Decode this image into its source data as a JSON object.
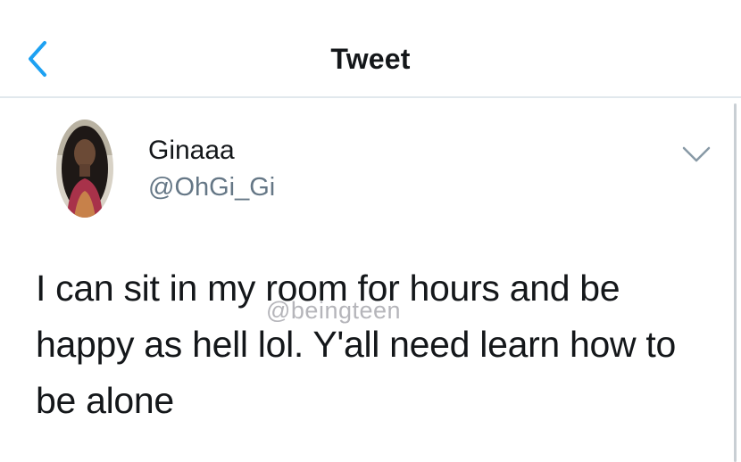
{
  "header": {
    "title": "Tweet",
    "back_icon": "chevron-left-icon",
    "accent_color": "#1da1f2"
  },
  "tweet": {
    "display_name": "Ginaaa",
    "handle": "@OhGi_Gi",
    "text": "I can sit in my room for hours and be happy as hell lol. Y'all need learn how to be alone",
    "menu_icon": "chevron-down-icon"
  },
  "watermark": {
    "text": "@beingteen"
  }
}
